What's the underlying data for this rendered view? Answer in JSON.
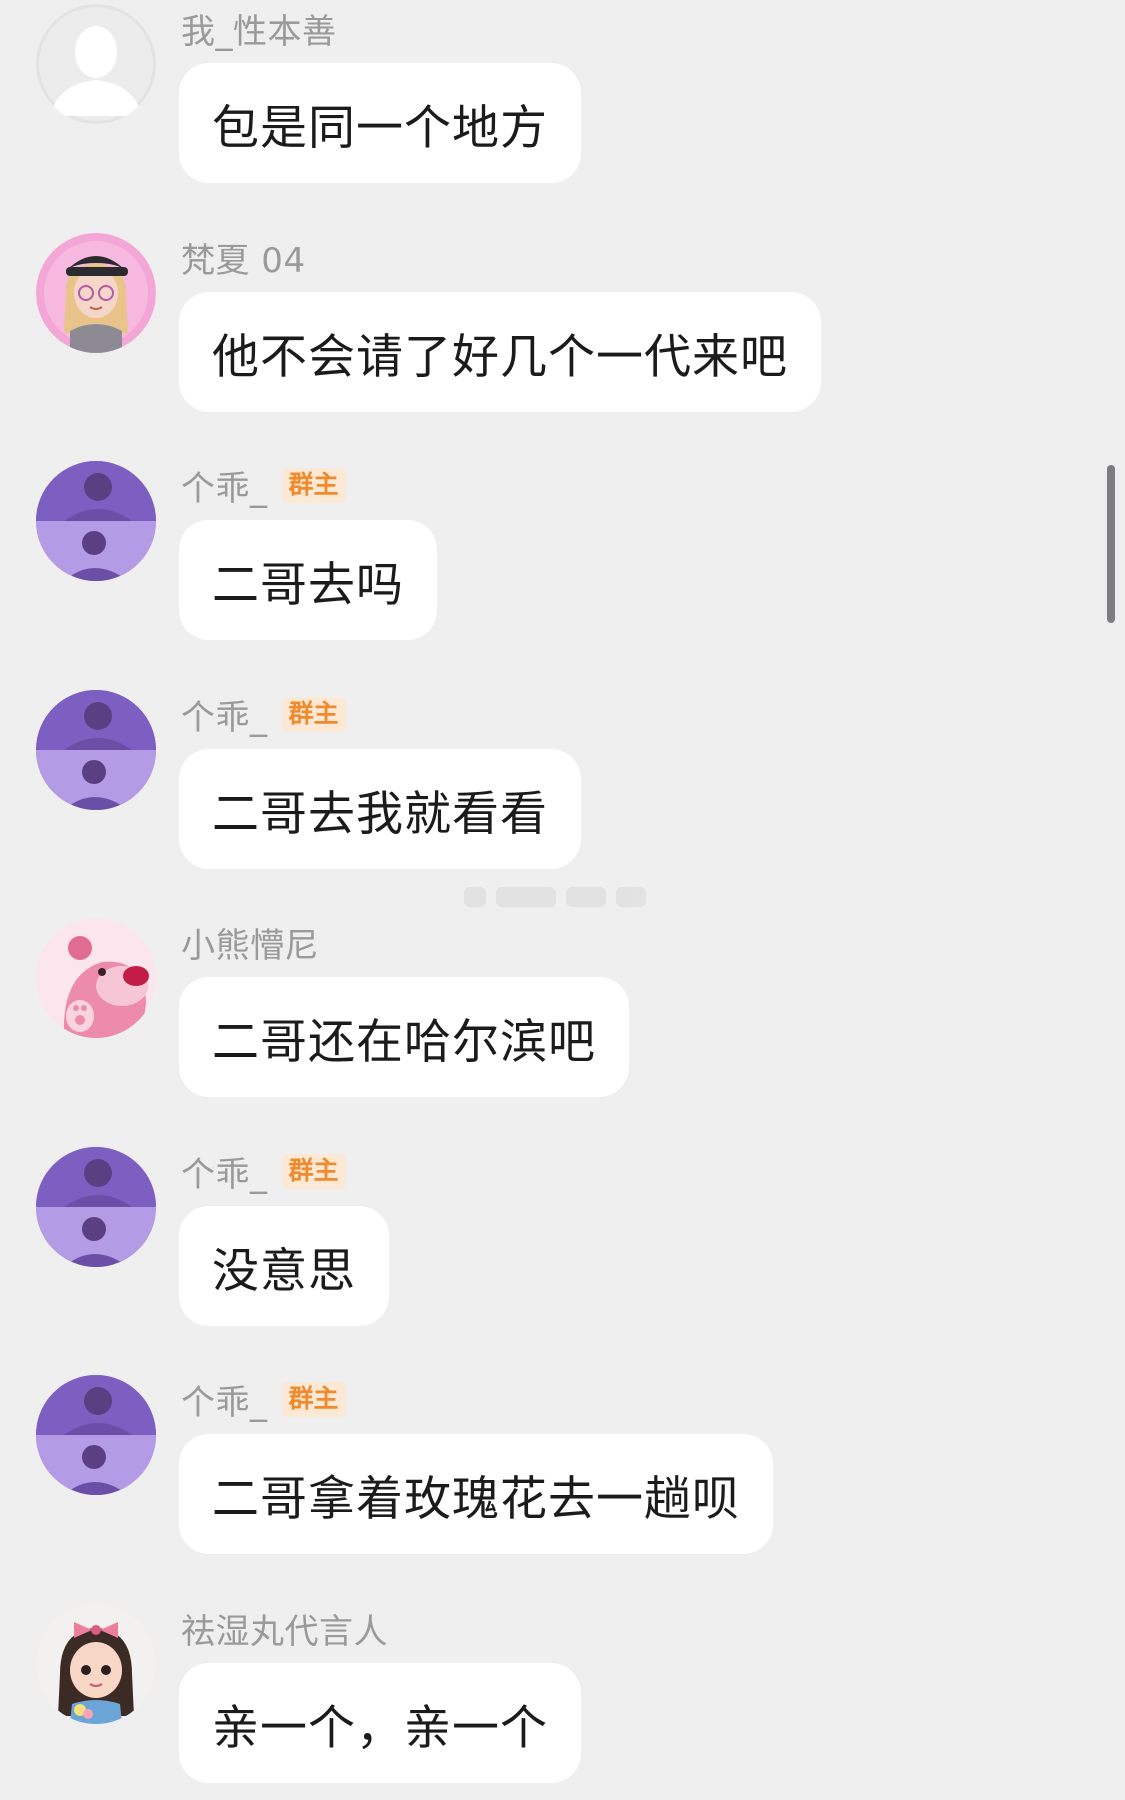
{
  "chat": {
    "messages": [
      {
        "sender": "我_性本善",
        "badge": "",
        "text": "包是同一个地方",
        "avatar": "default-person-icon"
      },
      {
        "sender": "梵夏 04",
        "badge": "",
        "text": "他不会请了好几个一代来吧",
        "avatar": "cartoon-girl-avatar"
      },
      {
        "sender": "个乖_",
        "badge": "群主",
        "text": "二哥去吗",
        "avatar": "purple-photo-avatar"
      },
      {
        "sender": "个乖_",
        "badge": "群主",
        "text": "二哥去我就看看",
        "avatar": "purple-photo-avatar"
      },
      {
        "sender": "小熊懵尼",
        "badge": "",
        "text": "二哥还在哈尔滨吧",
        "avatar": "pink-bear-avatar"
      },
      {
        "sender": "个乖_",
        "badge": "群主",
        "text": "没意思",
        "avatar": "purple-photo-avatar"
      },
      {
        "sender": "个乖_",
        "badge": "群主",
        "text": "二哥拿着玫瑰花去一趟呗",
        "avatar": "purple-photo-avatar"
      },
      {
        "sender": "祛湿丸代言人",
        "badge": "",
        "text": "亲一个，亲一个",
        "avatar": "cartoon-girl-bow-avatar"
      }
    ]
  },
  "colors": {
    "background": "#efeff0",
    "bubble": "#ffffff",
    "sender_name": "#9a9a9a",
    "badge_text": "#f08a2d",
    "badge_bg": "#fbe9d6"
  }
}
